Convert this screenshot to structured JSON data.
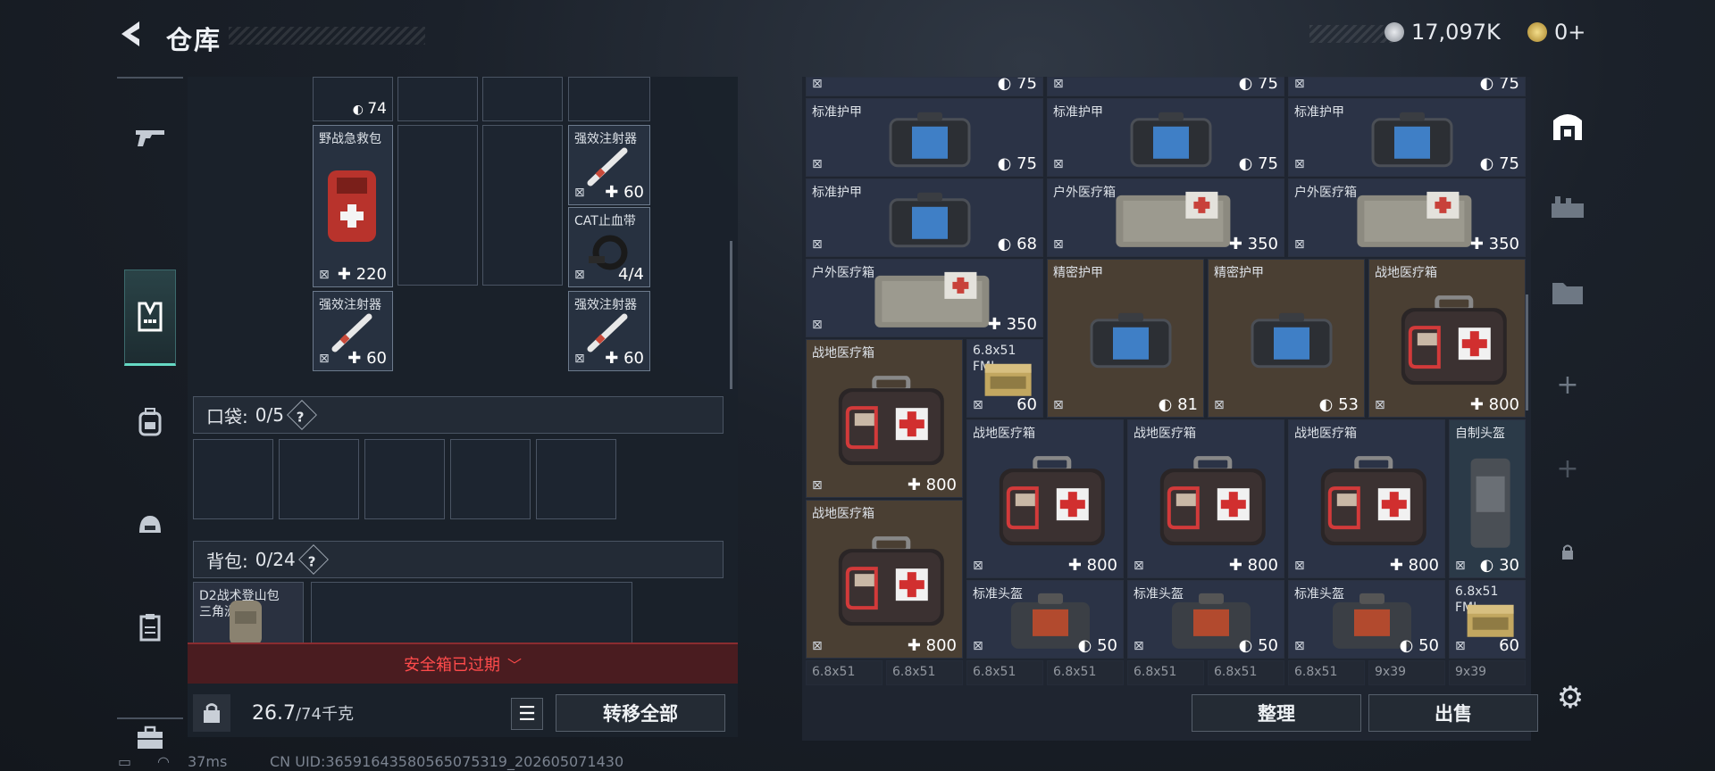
{
  "header": {
    "back_icon": "back-arrow-icon",
    "title": "仓库",
    "silver": "17,097K",
    "gold": "0+"
  },
  "left_nav": [
    "gun-icon",
    "vest-icon",
    "backpack-icon",
    "helmet-icon",
    "clipboard-icon",
    "briefcase-icon"
  ],
  "rig": {
    "top_values": [
      "74"
    ],
    "items": [
      {
        "name": "野战急救包",
        "value": "220"
      },
      {
        "name": "强效注射器",
        "value": "60"
      },
      {
        "name": "CAT止血带",
        "value": "4/4"
      },
      {
        "name": "强效注射器",
        "value": "60"
      },
      {
        "name": "强效注射器",
        "value": "60"
      }
    ]
  },
  "pocket": {
    "label": "口袋:",
    "count": "0/5",
    "help": "?"
  },
  "backpack": {
    "label": "背包:",
    "count": "0/24",
    "help": "?",
    "item_name": "D2战术登山包",
    "item_sub": "三角洲"
  },
  "safe_box": {
    "label": "安全箱已过期"
  },
  "footer": {
    "weight": "26.7",
    "weight_max": "/74千克",
    "transfer_all": "转移全部",
    "organize": "整理",
    "sell": "出售"
  },
  "storage": {
    "partial_top": [
      "75",
      "75",
      "75"
    ],
    "row1": [
      {
        "name": "标准护甲",
        "value": "75"
      },
      {
        "name": "标准护甲",
        "value": "75"
      },
      {
        "name": "标准护甲",
        "value": "75"
      }
    ],
    "row2": [
      {
        "name": "标准护甲",
        "value": "68"
      },
      {
        "name": "户外医疗箱",
        "value": "350"
      },
      {
        "name": "户外医疗箱",
        "value": "350"
      }
    ],
    "row3": [
      {
        "name": "户外医疗箱",
        "value": "350"
      },
      {
        "name": "精密护甲",
        "value": "81"
      },
      {
        "name": "精密护甲",
        "value": "53"
      },
      {
        "name": "战地医疗箱",
        "value": "800"
      }
    ],
    "ammo1": {
      "name": "6.8x51",
      "sub": "FMJ",
      "value": "60"
    },
    "medkits": [
      {
        "name": "战地医疗箱",
        "value": "800"
      },
      {
        "name": "战地医疗箱",
        "value": "800"
      },
      {
        "name": "战地医疗箱",
        "value": "800"
      },
      {
        "name": "战地医疗箱",
        "value": "800"
      },
      {
        "name": "战地医疗箱",
        "value": "800"
      }
    ],
    "homemade": {
      "name": "自制头盔",
      "value": "30"
    },
    "helmets": [
      {
        "name": "标准头盔",
        "value": "50"
      },
      {
        "name": "标准头盔",
        "value": "50"
      },
      {
        "name": "标准头盔",
        "value": "50"
      }
    ],
    "ammo2": {
      "name": "6.8x51",
      "sub": "FMJ",
      "value": "60"
    },
    "bottom_row": [
      "6.8x51",
      "6.8x51",
      "6.8x51",
      "6.8x51",
      "6.8x51",
      "6.8x51",
      "6.8x51",
      "9x39",
      "9x39"
    ]
  },
  "right_nav": [
    "storage-icon",
    "gun-rack-icon",
    "folder-icon",
    "add-icon",
    "add-icon",
    "lock-icon"
  ],
  "status": {
    "ping": "37ms",
    "uid": "CN UID:3659164358056507531​9_202605071430"
  },
  "colors": {
    "accent": "#66d9c4",
    "danger": "#ff4b4b"
  }
}
